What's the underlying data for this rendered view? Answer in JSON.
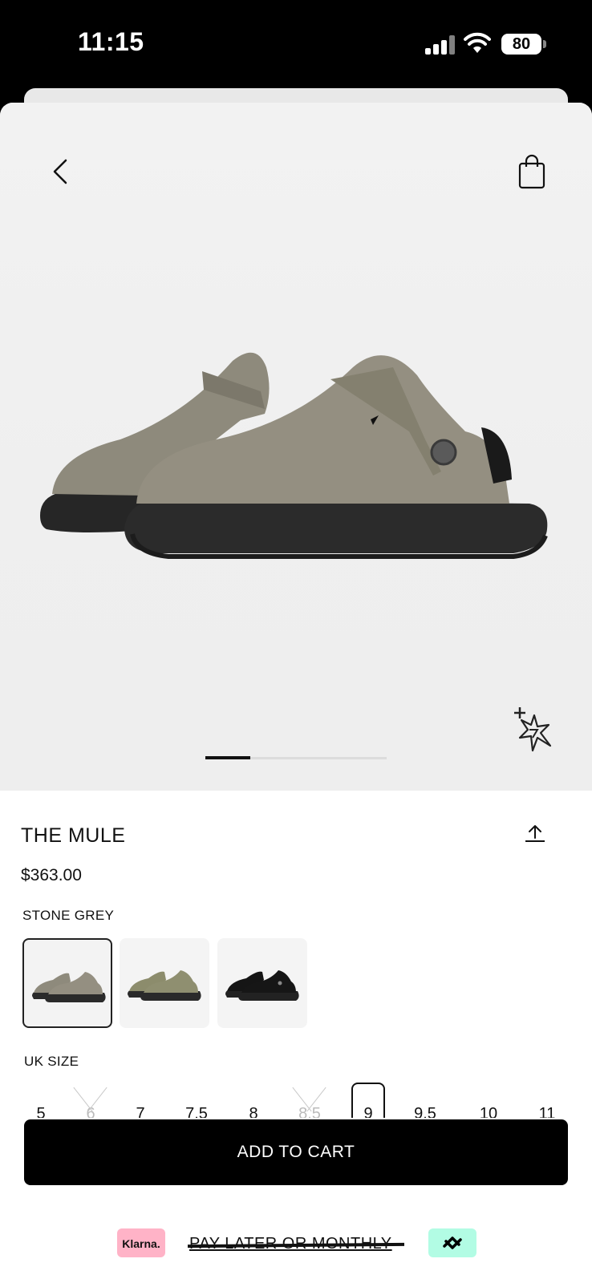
{
  "status_bar": {
    "time": "11:15",
    "battery": "80"
  },
  "product": {
    "title": "THE MULE",
    "price": "$363.00",
    "color_name": "STONE GREY",
    "image_pager": {
      "current": 1,
      "total": 4
    }
  },
  "swatches": [
    {
      "name": "stone-grey",
      "selected": true,
      "upper": "#8e8a7c",
      "sole": "#2a2a2a"
    },
    {
      "name": "olive",
      "selected": false,
      "upper": "#8c8c6c",
      "sole": "#2a2a2a"
    },
    {
      "name": "black",
      "selected": false,
      "upper": "#151515",
      "sole": "#202020"
    }
  ],
  "sizes": {
    "label": "UK SIZE",
    "options": [
      {
        "value": "5",
        "available": true
      },
      {
        "value": "6",
        "available": false
      },
      {
        "value": "7",
        "available": true
      },
      {
        "value": "7.5",
        "available": true
      },
      {
        "value": "8",
        "available": true
      },
      {
        "value": "8.5",
        "available": false
      },
      {
        "value": "9",
        "available": true,
        "selected": true
      },
      {
        "value": "9.5",
        "available": true
      },
      {
        "value": "10",
        "available": true
      },
      {
        "value": "11",
        "available": true
      }
    ]
  },
  "actions": {
    "add_to_cart": "ADD TO CART"
  },
  "payment": {
    "klarna_label": "Klarna.",
    "pay_later_text": "PAY LATER OR MONTHLY"
  },
  "icons": {
    "back": "chevron-left-icon",
    "bag": "shopping-bag-icon",
    "share": "share-upload-icon",
    "sparkle": "sparkle-icon",
    "afterpay": "afterpay-logo-icon"
  },
  "colors": {
    "accent": "#000000",
    "klarna_pink": "#ffb3c7",
    "afterpay_mint": "#b2fce4"
  }
}
